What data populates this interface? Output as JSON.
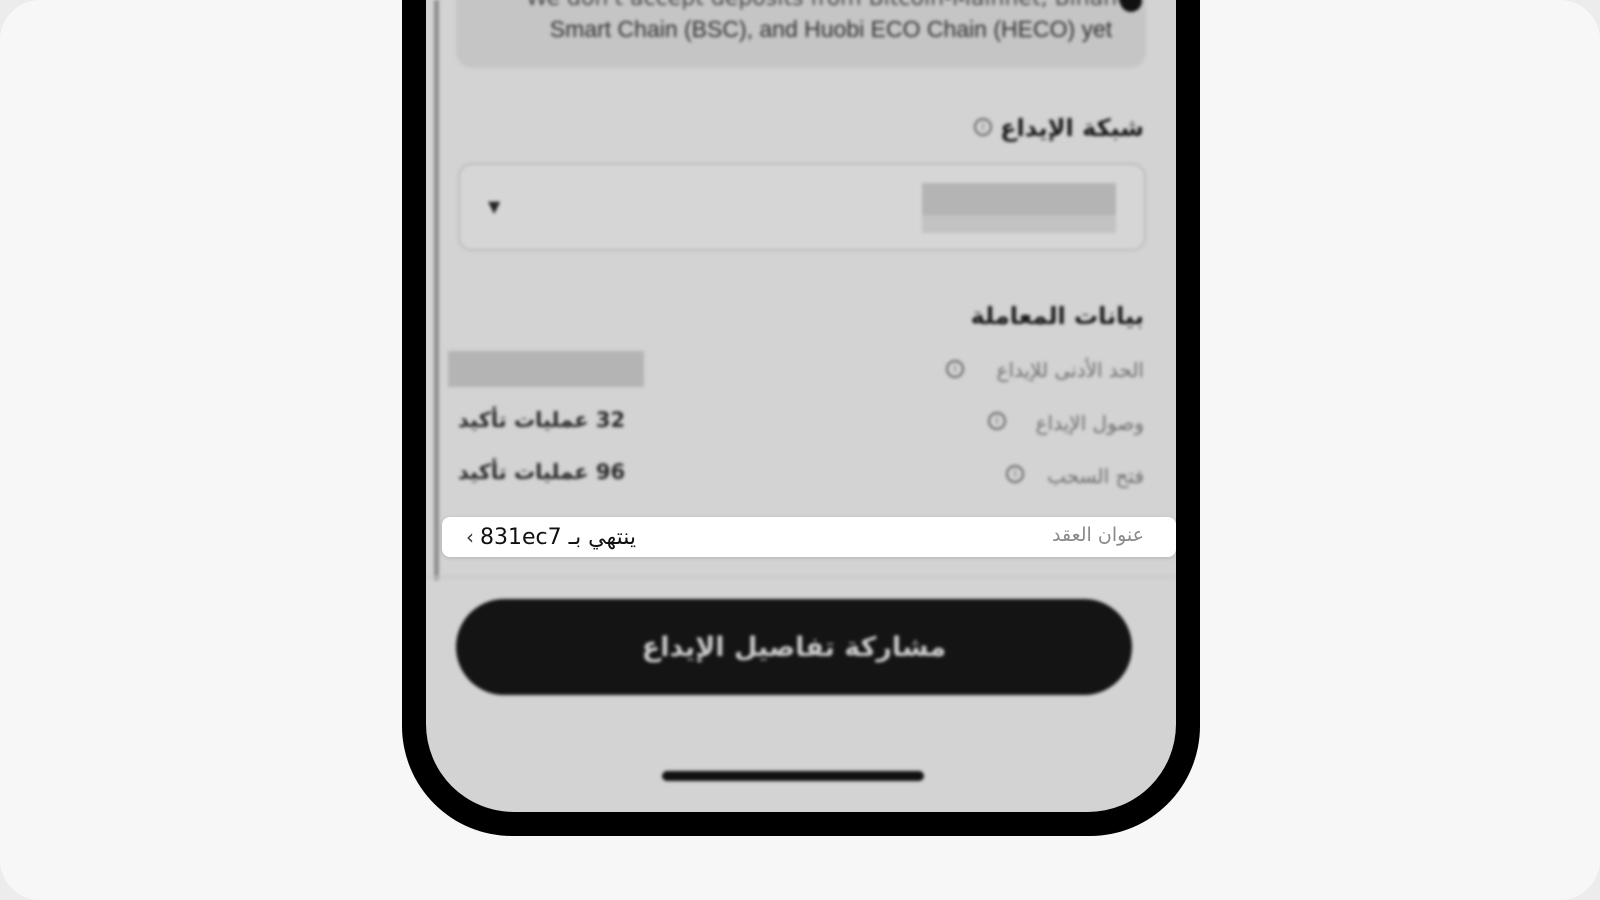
{
  "notice": {
    "line1": "We don't accept deposits from Bitcoin-Mainnet, Binance",
    "line2": "Smart Chain (BSC), and Huobi ECO Chain (HECO) yet"
  },
  "deposit_network": {
    "title": "شبكة الإيداع",
    "info_icon": "info-icon",
    "dropdown_icon": "caret-down-icon"
  },
  "transaction_details": {
    "title": "بيانات المعاملة",
    "rows": [
      {
        "label": "الحد الأدنى للإيداع",
        "value": ""
      },
      {
        "label": "وصول الإيداع",
        "value": "32 عمليات تأكيد"
      },
      {
        "label": "فتح السحب",
        "value": "96 عمليات تأكيد"
      }
    ]
  },
  "contract_address": {
    "label": "عنوان العقد",
    "value": "ينتهي بـ 831ec7",
    "icon": "chevron-right-icon"
  },
  "share_button": {
    "label": "مشاركة تفاصيل الإيداع"
  },
  "colors": {
    "screen_background": "#d3d3d3",
    "button_background": "#141414",
    "highlight_background": "#ffffff"
  }
}
